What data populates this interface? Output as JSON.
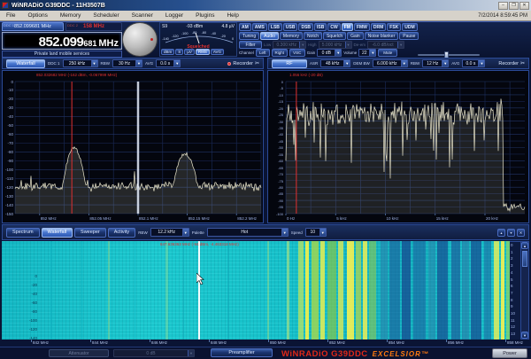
{
  "window": {
    "title": "WiNRADiO G39DDC - 11H3507B",
    "datetime": "7/2/2014 8:59:45 PM",
    "minimize": "–",
    "maximize": "❐",
    "close": "✕"
  },
  "menu": {
    "items": [
      "File",
      "Options",
      "Memory",
      "Scheduler",
      "Scanner",
      "Logger",
      "Plugins",
      "Help"
    ]
  },
  "ddc": {
    "tab1_label": "DDC 1",
    "tab1_freq": "852.099681 MHz",
    "tab2_label": "DDC 2",
    "tab2_freq": "158 MHz"
  },
  "freq": {
    "main": "852.099",
    "sub": "681",
    "unit": "MHz",
    "service": "Private land mobile services"
  },
  "smeter": {
    "s": "S9",
    "dbm": "-93 dBm",
    "uv": "4.8 µV",
    "status": "Squelched",
    "scale": [
      "-140",
      "-120",
      "-100",
      "-80",
      "-60",
      "-40",
      "-20",
      "0"
    ],
    "buttons": [
      "dBm",
      "S",
      "µV",
      "RMS",
      "AVG"
    ],
    "active_button": "RMS"
  },
  "modes": {
    "items": [
      "AM",
      "AMS",
      "LSB",
      "USB",
      "DSB",
      "ISB",
      "CW",
      "FM",
      "FMW",
      "DRM",
      "FSK",
      "UDM"
    ],
    "active": "FM"
  },
  "ctrl": {
    "row2": [
      "Tuning",
      "Audio",
      "Memory",
      "Notch",
      "Squelch",
      "Gain",
      "Noise blanker",
      "Pause"
    ],
    "row2_active": "Audio",
    "filter_label": "Filter",
    "low_label": "Low",
    "low": "0.300 kHz",
    "high_label": "High",
    "high": "5.000 kHz",
    "deem_label": "De-em",
    "deem": "-6.0 dB/oct",
    "channel_label": "Channel",
    "left": "Left",
    "right": "Right",
    "vsc": "VSC",
    "gain_label": "Gain",
    "gain": "0 dB",
    "volume_label": "Volume",
    "volume": "22",
    "mute": "Mute"
  },
  "lheader": {
    "waterfall": "Waterfall",
    "ddc": "DDC 1",
    "bw": "250 kHz",
    "rbw_label": "RBW",
    "rbw": "30 Hz",
    "avg_label": "AVG",
    "avg": "0.0 s",
    "recorder": "Recorder"
  },
  "rheader": {
    "rf": "RF",
    "asr_label": "ASR",
    "asr": "48 kHz",
    "dembw_label": "DEM BW",
    "dembw": "6.000 kHz",
    "rbw_label": "RBW",
    "rbw": "12 Hz",
    "avg_label": "AVG",
    "avg": "0.0 s",
    "recorder": "Recorder"
  },
  "waterfall": {
    "tabs": [
      "Spectrum",
      "Waterfall",
      "Sweeper",
      "Activity"
    ],
    "active_tab": "Waterfall",
    "rbw_label": "RBW",
    "rbw": "12.2 kHz",
    "palette_label": "Palette",
    "palette": "Hot",
    "speed_label": "Speed",
    "speed": "10",
    "tool_buttons": [
      "▴",
      "▾",
      "✕"
    ]
  },
  "bottom": {
    "attenuator": "Attenuator",
    "atten_value": "0 dB",
    "preamp": "Preamplifier",
    "brand1": "WiNRADiO G39DDC",
    "brand2": "EXCELSIOR™",
    "power": "Power"
  },
  "chart_data": [
    {
      "type": "line",
      "name": "ddc1-spectrum",
      "annotation": "852.032682 MHz (-162 dBm, -0.067999 MHz)",
      "x_range_mhz": [
        851.975,
        852.225
      ],
      "x_ticks": [
        "852 MHz",
        "852.05 MHz",
        "852.1 MHz",
        "852.15 MHz",
        "852.2 MHz"
      ],
      "x_tick_fracs": [
        0.1,
        0.3,
        0.5,
        0.7,
        0.9
      ],
      "y_range_dbm": [
        -150,
        0
      ],
      "y_tick_step": 10,
      "noise_floor_dbm": -119,
      "noise_amp_db": 6,
      "peaks": [
        {
          "freq_mhz": 852.035,
          "level_dbm": -75,
          "half_width_mhz": 0.012
        },
        {
          "freq_mhz": 852.148,
          "level_dbm": -82,
          "half_width_mhz": 0.014
        }
      ],
      "marker_freq_mhz": 852.0327,
      "center_freq_mhz": 852.1,
      "trace_color": "#ece8cd",
      "marker_color": "#e03030"
    },
    {
      "type": "line",
      "name": "audio-spectrum",
      "annotation": "1.056 kHz (-20 dB)",
      "x_range_khz": [
        0,
        24
      ],
      "x_ticks": [
        "0 Hz",
        "5 kHz",
        "10 kHz",
        "15 kHz",
        "20 kHz"
      ],
      "x_tick_fracs": [
        0,
        0.2083,
        0.4167,
        0.625,
        0.8333
      ],
      "y_range_db": [
        -100,
        0
      ],
      "y_tick_step": 5,
      "mean_level_db": -24,
      "noise_amp_db": 9,
      "cutoff_khz": 21.8,
      "spike_khz": 21.6,
      "marker_khz": 1.056,
      "trace_color": "#ece8cd",
      "marker_color": "#e03030"
    },
    {
      "type": "heatmap",
      "name": "waterfall",
      "annotation": "847.636363 MHz (-94 dBm, -4.463318 MHz)",
      "x_ticks": [
        "842 MHz",
        "844 MHz",
        "846 MHz",
        "848 MHz",
        "850 MHz",
        "852 MHz",
        "854 MHz",
        "856 MHz",
        "858 MHz"
      ],
      "time_ticks": [
        "0",
        "1",
        "2",
        "3",
        "4",
        "5",
        "6",
        "7",
        "8",
        "9",
        "10",
        "11",
        "12",
        "13"
      ],
      "level_ticks": [
        "0",
        "-20",
        "-40",
        "-60",
        "-80",
        "-100",
        "-120",
        "-140"
      ],
      "marker_freq_mhz": 847.636363,
      "base_color": "#17c6cf",
      "stripes": [
        {
          "x": 55,
          "w": 2,
          "c": "#0fb0c0",
          "o": 0.6
        },
        {
          "x": 90,
          "w": 1,
          "c": "#0aa8b8",
          "o": 0.5
        },
        {
          "x": 120,
          "w": 2,
          "c": "#bfe878",
          "o": 0.35
        },
        {
          "x": 150,
          "w": 1,
          "c": "#0fb0c0",
          "o": 0.5
        },
        {
          "x": 185,
          "w": 3,
          "c": "#bfe878",
          "o": 0.3
        },
        {
          "x": 205,
          "w": 1,
          "c": "#0aa0b0",
          "o": 0.5
        },
        {
          "x": 222,
          "w": 2,
          "c": "#ffffff",
          "o": 0.95
        },
        {
          "x": 255,
          "w": 2,
          "c": "#10a8b8",
          "o": 0.5
        },
        {
          "x": 300,
          "w": 2,
          "c": "#bfe878",
          "o": 0.4
        },
        {
          "x": 322,
          "w": 3,
          "c": "#d8ee6a",
          "o": 0.5
        },
        {
          "x": 335,
          "w": 6,
          "c": "#c8e858",
          "o": 0.7
        },
        {
          "x": 343,
          "w": 4,
          "c": "#f2f24a",
          "o": 0.9
        },
        {
          "x": 350,
          "w": 8,
          "c": "#a8d84a",
          "o": 0.8
        },
        {
          "x": 360,
          "w": 5,
          "c": "#e8ee50",
          "o": 0.85
        },
        {
          "x": 368,
          "w": 10,
          "c": "#86c84a",
          "o": 0.7
        },
        {
          "x": 380,
          "w": 6,
          "c": "#e0ea55",
          "o": 0.8
        },
        {
          "x": 390,
          "w": 8,
          "c": "#f6f150",
          "o": 0.9
        },
        {
          "x": 400,
          "w": 6,
          "c": "#b0d850",
          "o": 0.75
        },
        {
          "x": 408,
          "w": 5,
          "c": "#eef055",
          "o": 0.85
        },
        {
          "x": 415,
          "w": 8,
          "c": "#90c850",
          "o": 0.6
        },
        {
          "x": 428,
          "w": 8,
          "c": "#2a7ca8",
          "o": 0.55
        },
        {
          "x": 438,
          "w": 12,
          "c": "#1c5a9a",
          "o": 0.6
        },
        {
          "x": 452,
          "w": 10,
          "c": "#15428c",
          "o": 0.7
        },
        {
          "x": 465,
          "w": 14,
          "c": "#1c5a9a",
          "o": 0.55
        },
        {
          "x": 482,
          "w": 8,
          "c": "#2a7ca8",
          "o": 0.5
        },
        {
          "x": 492,
          "w": 12,
          "c": "#15428c",
          "o": 0.65
        },
        {
          "x": 508,
          "w": 10,
          "c": "#1a4e92",
          "o": 0.6
        },
        {
          "x": 520,
          "w": 8,
          "c": "#2a6ca0",
          "o": 0.5
        },
        {
          "x": 530,
          "w": 12,
          "c": "#153e88",
          "o": 0.65
        },
        {
          "x": 545,
          "w": 8,
          "c": "#1c5a9a",
          "o": 0.5
        },
        {
          "x": 556,
          "w": 6,
          "c": "#eef055",
          "o": 0.8
        },
        {
          "x": 564,
          "w": 4,
          "c": "#f6f150",
          "o": 0.9
        },
        {
          "x": 570,
          "w": 4,
          "c": "#a8d84a",
          "o": 0.6
        }
      ]
    }
  ]
}
